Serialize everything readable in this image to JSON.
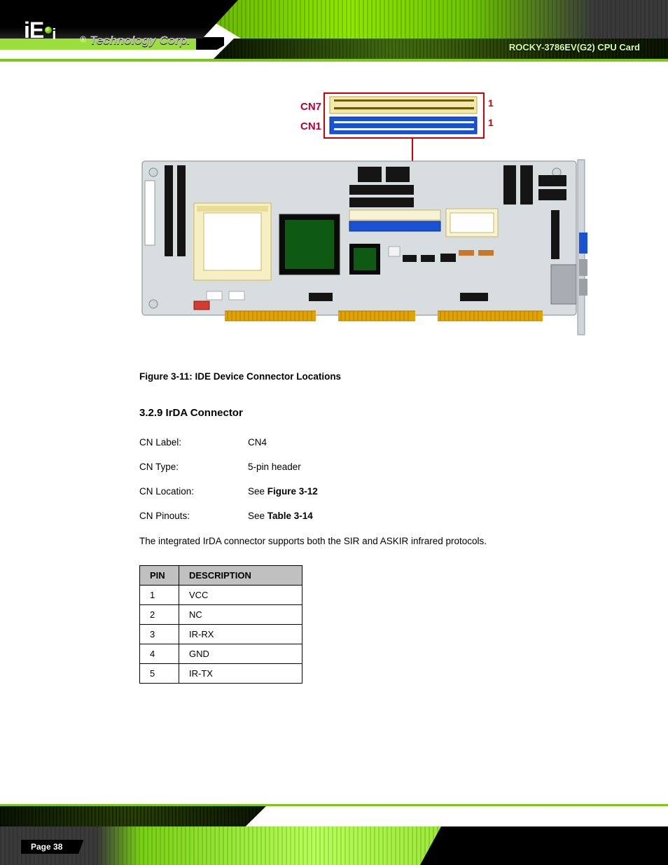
{
  "brand": {
    "name": "iEi",
    "reg": "®",
    "tagline": "Technology Corp."
  },
  "header_title": "ROCKY-3786EV(G2) CPU Card",
  "figure_caption": "Figure 3-11: IDE Device Connector Locations",
  "diagram": {
    "callouts": {
      "cn7": "CN7",
      "cn1": "CN1"
    },
    "pin1_a": "1",
    "pin1_b": "1"
  },
  "section_heading": "3.2.9 IrDA Connector",
  "specs": [
    {
      "k": "CN Label:",
      "v_plain": "CN4"
    },
    {
      "k": "CN Type:",
      "v_plain": "5-pin header"
    },
    {
      "k": "CN Location:",
      "v_prefix": "See ",
      "v_ref": "Figure 3-12"
    },
    {
      "k": "CN Pinouts:",
      "v_prefix": "See ",
      "v_ref": "Table 3-14"
    }
  ],
  "paragraph": "The integrated IrDA connector supports both the SIR and ASKIR infrared protocols.",
  "pin_table": {
    "headers": [
      "PIN",
      "DESCRIPTION"
    ],
    "rows": [
      [
        "1",
        "VCC"
      ],
      [
        "2",
        "NC"
      ],
      [
        "3",
        "IR-RX"
      ],
      [
        "4",
        "GND"
      ],
      [
        "5",
        "IR-TX"
      ]
    ]
  },
  "footer": {
    "page_label": "Page",
    "page_number": "38"
  }
}
